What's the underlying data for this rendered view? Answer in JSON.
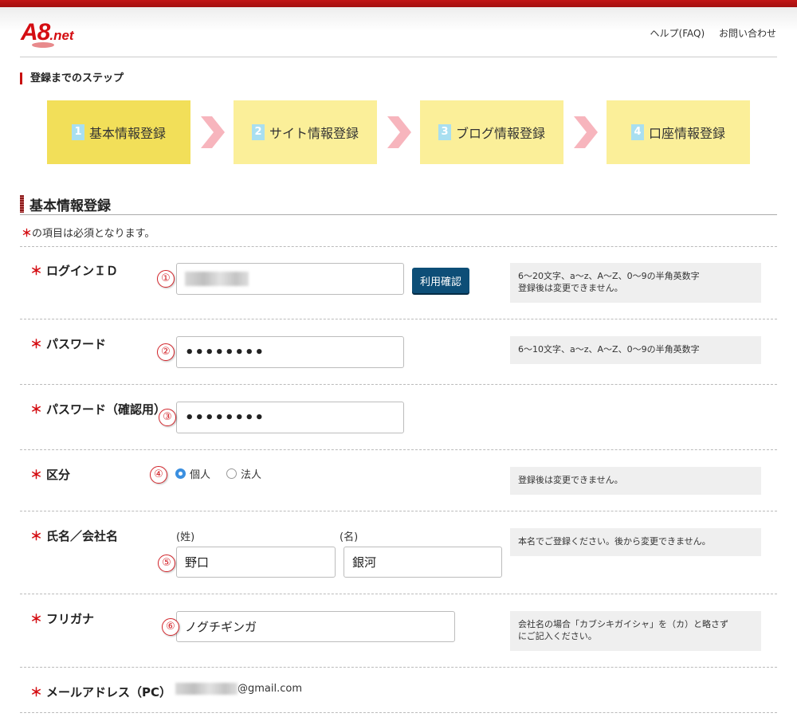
{
  "logo": {
    "text_big": "A8",
    "text_small": ".net"
  },
  "header": {
    "help_link": "ヘルプ(FAQ)",
    "contact_link": "お問い合わせ"
  },
  "steps": {
    "title": "登録までのステップ",
    "items": [
      {
        "num": "1",
        "label": "基本情報登録"
      },
      {
        "num": "2",
        "label": "サイト情報登録"
      },
      {
        "num": "3",
        "label": "ブログ情報登録"
      },
      {
        "num": "4",
        "label": "口座情報登録"
      }
    ]
  },
  "section": {
    "title": "基本情報登録",
    "required_note": "の項目は必須となります。",
    "required_mark": "＊"
  },
  "form": {
    "login_id": {
      "label": "ログインＩＤ",
      "num": "①",
      "check_button": "利用確認",
      "hint_line1": "6～20文字、a～z、A～Z、0～9の半角英数字",
      "hint_line2": "登録後は変更できません。"
    },
    "password": {
      "label": "パスワード",
      "num": "②",
      "value": "••••••••",
      "hint": "6～10文字、a～z、A～Z、0～9の半角英数字"
    },
    "password_confirm": {
      "label": "パスワード（確認用）",
      "num": "③",
      "value": "••••••••"
    },
    "category": {
      "label": "区分",
      "num": "④",
      "option_individual": "個人",
      "option_corporate": "法人",
      "selected": "個人",
      "hint": "登録後は変更できません。"
    },
    "name": {
      "label": "氏名／会社名",
      "num": "⑤",
      "surname_label": "(姓)",
      "given_label": "(名)",
      "surname_value": "野口",
      "given_value": "銀河",
      "hint": "本名でご登録ください。後から変更できません。"
    },
    "furigana": {
      "label": "フリガナ",
      "num": "⑥",
      "value": "ノグチギンガ",
      "hint_line1": "会社名の場合「カブシキガイシャ」を（カ）と略さず",
      "hint_line2": "にご記入ください。"
    },
    "email": {
      "label": "メールアドレス（PC）",
      "domain": "@gmail.com"
    }
  },
  "colors": {
    "brand_red": "#d40d12",
    "step_active": "#f2df59",
    "step_inactive": "#fbef99",
    "button_blue": "#0d4e77"
  }
}
